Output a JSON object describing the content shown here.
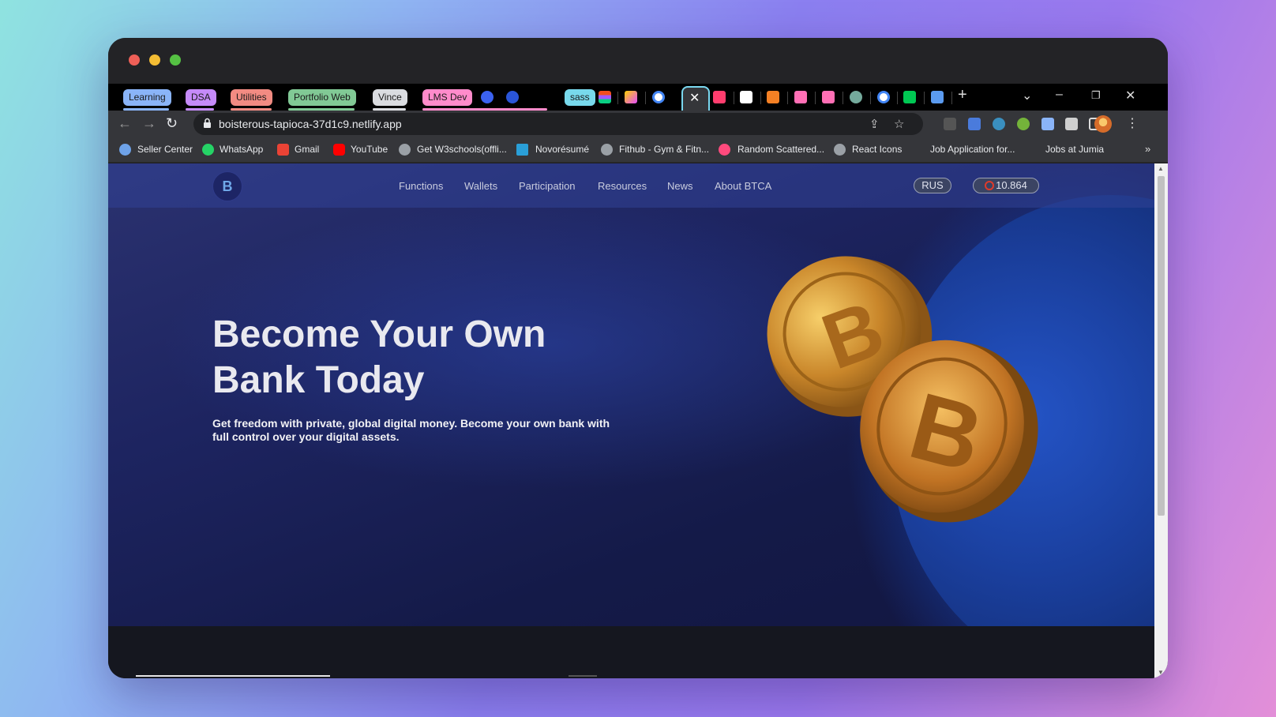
{
  "tab_groups": [
    {
      "label": "Learning",
      "color": "#8ab4f8"
    },
    {
      "label": "DSA",
      "color": "#c58af9"
    },
    {
      "label": "Utilities",
      "color": "#f28b82"
    },
    {
      "label": "Portfolio Web",
      "color": "#81c995"
    },
    {
      "label": "Vince",
      "color": "#dadce0"
    },
    {
      "label": "LMS Dev",
      "color": "#ff8bcb"
    },
    {
      "label": "sass",
      "color": "#78d9ec"
    }
  ],
  "window_controls": {
    "dropdown": "⌄",
    "minimize": "–",
    "restore": "❐",
    "close": "✕",
    "new_tab": "+",
    "tab_close": "✕"
  },
  "omnibox": {
    "url": "boisterous-tapioca-37d1c9.netlify.app"
  },
  "nav": {
    "back": "←",
    "forward": "→",
    "reload": "↻"
  },
  "bookmarks": [
    {
      "label": "Seller Center",
      "icon": "globe-icon"
    },
    {
      "label": "WhatsApp",
      "icon": "whatsapp-icon"
    },
    {
      "label": "Gmail",
      "icon": "gmail-icon"
    },
    {
      "label": "YouTube",
      "icon": "youtube-icon"
    },
    {
      "label": "Get W3schools(offli...",
      "icon": "globe-icon"
    },
    {
      "label": "Novorésumé",
      "icon": "novoresume-icon"
    },
    {
      "label": "Fithub - Gym & Fitn...",
      "icon": "globe-icon"
    },
    {
      "label": "Random Scattered...",
      "icon": "rss-icon"
    },
    {
      "label": "React Icons",
      "icon": "globe-icon"
    },
    {
      "label": "Job Application for...",
      "icon": ""
    },
    {
      "label": "Jobs at Jumia",
      "icon": ""
    }
  ],
  "bookmarks_more": "»",
  "site": {
    "logo_glyph": "B",
    "nav_links": [
      "Functions",
      "Wallets",
      "Participation",
      "Resources",
      "News",
      "About BTCA"
    ],
    "language": "RUS",
    "balance": "10.864",
    "headline": "Become Your Own Bank Today",
    "subtext": "Get freedom with private, global digital money. Become your own bank with full control over your digital assets."
  }
}
